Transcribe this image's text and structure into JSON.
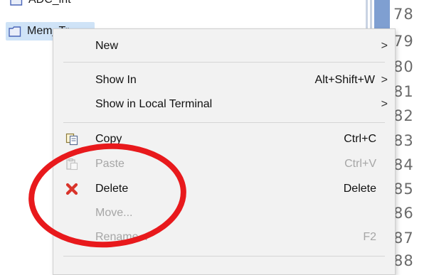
{
  "tree": {
    "items": [
      {
        "label": "ADC_int",
        "icon": "folder-icon"
      },
      {
        "label": "Mem_Tr",
        "icon": "folder-icon",
        "selected": true
      }
    ]
  },
  "editor": {
    "line_numbers": [
      "78",
      "79",
      "80",
      "81",
      "82",
      "83",
      "84",
      "85",
      "86",
      "87",
      "88"
    ]
  },
  "context_menu": {
    "new": {
      "label": "New",
      "has_submenu": true
    },
    "show_in": {
      "label": "Show In",
      "shortcut": "Alt+Shift+W",
      "has_submenu": true
    },
    "show_in_local_terminal": {
      "label": "Show in Local Terminal",
      "has_submenu": true
    },
    "copy": {
      "label": "Copy",
      "shortcut": "Ctrl+C",
      "icon": "copy-icon"
    },
    "paste": {
      "label": "Paste",
      "shortcut": "Ctrl+V",
      "icon": "paste-icon",
      "disabled": true
    },
    "delete": {
      "label": "Delete",
      "shortcut": "Delete",
      "icon": "delete-icon"
    },
    "move": {
      "label": "Move...",
      "disabled": true
    },
    "rename": {
      "label": "Rename...",
      "shortcut": "F2",
      "disabled": true
    },
    "submenu_arrow": ">"
  },
  "colors": {
    "selection": "#cfe3f7",
    "menu_background": "#f2f2f2",
    "annotation": "#e8191c",
    "delete_icon": "#d9342b"
  }
}
